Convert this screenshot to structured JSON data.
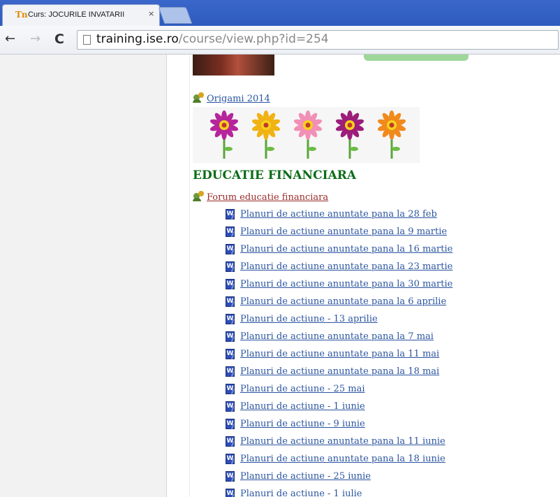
{
  "browser": {
    "tab_title": "Curs: JOCURILE INVATARII",
    "tab_close": "×",
    "favicon_text": "Tn",
    "url_host": "training.ise.ro",
    "url_path": "/course/view.php?id=254",
    "back_symbol": "←",
    "forward_symbol": "→",
    "reload_symbol": "C"
  },
  "origami": {
    "link_label": "Origami 2014",
    "flower_colors": [
      "#b6259b",
      "#f0b214",
      "#f28fb5",
      "#9c1e7a",
      "#f18a1d"
    ]
  },
  "section": {
    "title": "EDUCATIE FINANCIARA",
    "forum_label": "Forum educatie financiara",
    "documents": [
      "Planuri de actiune anuntate pana la 28 feb",
      "Planuri de actiune anuntate pana la 9 martie",
      "Planuri de actiune anuntate pana la 16 martie",
      "Planuri de actiune anuntate pana la 23 martie",
      "Planuri de actiune anuntate pana la 30 martie",
      "Planuri de actiune anuntate pana la 6 aprilie",
      "Planuri de actiune - 13 aprilie",
      "Planuri de actiune anuntate pana la 7 mai",
      "Planuri de actiune anuntate pana la 11 mai",
      "Planuri de actiune anuntate pana la 18 mai",
      "Planuri de actiune - 25 mai",
      "Planuri de actiune - 1 iunie",
      "Planuri de actiune - 9 iunie",
      "Planuri de actiune anuntate pana la 11 iunie",
      "Planuri de actiune anuntate pana la 18 iunie",
      "Planuri de actiune - 25 iunie",
      "Planuri de actiune - 1 iulie"
    ]
  },
  "icons": {
    "tab_favicon": "moodle-favicon-icon",
    "page": "page-icon",
    "forum": "forum-icon",
    "document": "word-document-icon"
  }
}
